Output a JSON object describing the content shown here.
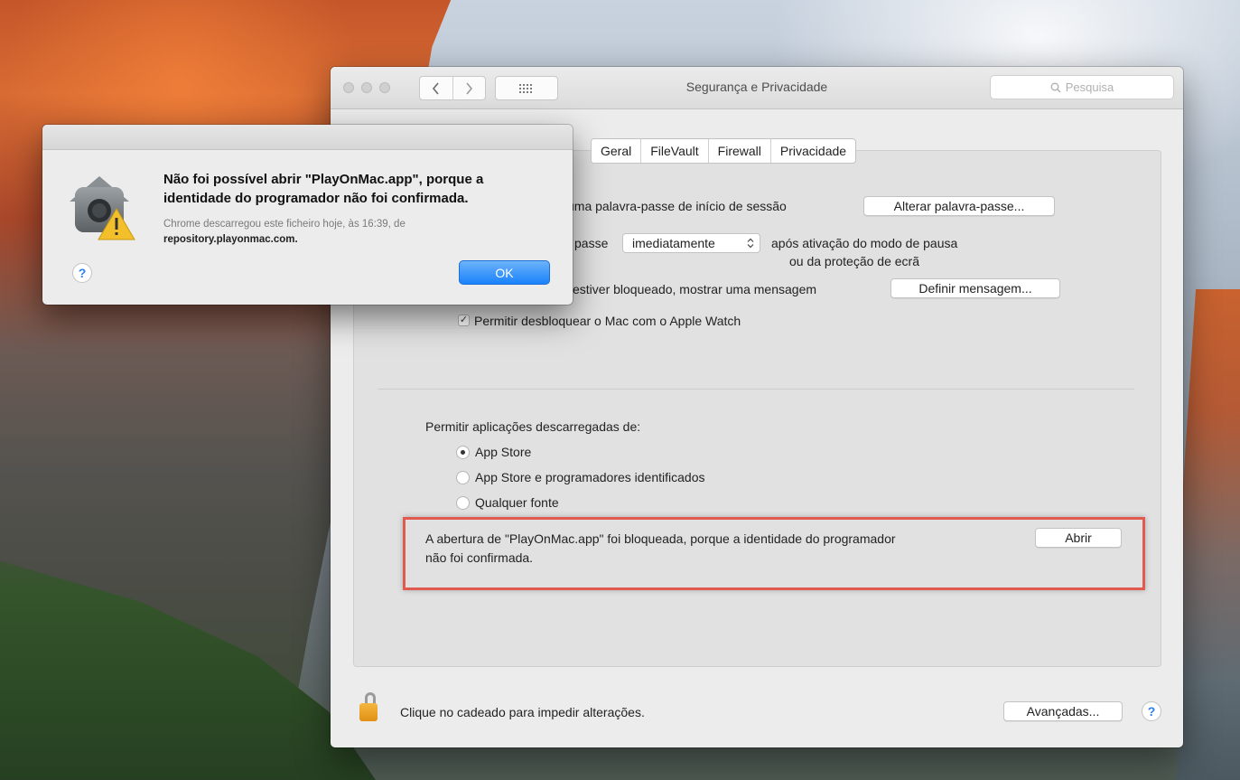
{
  "prefs": {
    "title": "Segurança e Privacidade",
    "search_placeholder": "Pesquisa",
    "tabs": [
      "Geral",
      "FileVault",
      "Firewall",
      "Privacidade"
    ],
    "row1_text": "uma palavra-passe de início de sessão",
    "change_password_button": "Alterar palavra-passe...",
    "row2_prefix": "passe",
    "require_password_value": "imediatamente",
    "row2_suffix_line1": "após ativação do modo de pausa",
    "row2_suffix_line2": "ou da proteção de ecrã",
    "row3_text": "estiver bloqueado, mostrar uma mensagem",
    "set_message_button": "Definir mensagem...",
    "apple_watch_checkbox_label": "Permitir desbloquear o Mac com o Apple Watch",
    "apple_watch_checked_mark": "✓",
    "allow_apps_label": "Permitir aplicações descarregadas de:",
    "radio_options": [
      "App Store",
      "App Store e programadores identificados",
      "Qualquer fonte"
    ],
    "selected_radio": "App Store",
    "blocked_message_line1": "A abertura de \"PlayOnMac.app\" foi bloqueada, porque a identidade do programador",
    "blocked_message_line2": "não foi confirmada.",
    "open_button": "Abrir",
    "lock_text": "Clique no cadeado para impedir alterações.",
    "advanced_button": "Avançadas...",
    "help_label": "?"
  },
  "alert": {
    "title": "Não foi possível abrir \"PlayOnMac.app\", porque a identidade do programador não foi confirmada.",
    "body_line1": "Chrome descarregou este ficheiro hoje, às 16:39, de",
    "body_line2": "repository.playonmac.com.",
    "ok_button": "OK",
    "help_label": "?"
  },
  "colors": {
    "ok_button": "#1a82fb",
    "highlight_border": "#e05a50",
    "lock": "#f5b740"
  }
}
